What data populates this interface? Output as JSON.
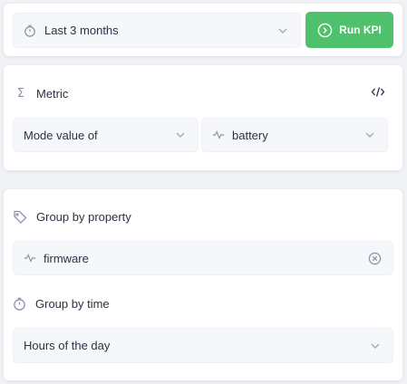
{
  "date_range": {
    "value": "Last 3 months"
  },
  "run_button": {
    "label": "Run KPI"
  },
  "metric": {
    "title": "Metric",
    "aggregation": "Mode value of",
    "property": "battery"
  },
  "group_by_property": {
    "title": "Group by property",
    "value": "firmware"
  },
  "group_by_time": {
    "title": "Group by time",
    "value": "Hours of the day"
  },
  "colors": {
    "accent_green": "#4fc06b",
    "field_bg": "#f5f7fb",
    "text": "#2b3245",
    "icon": "#8a92a6"
  },
  "icons": [
    "stopwatch-icon",
    "chevron-down-icon",
    "play-circle-icon",
    "sigma-icon",
    "code-icon",
    "activity-icon",
    "tag-icon",
    "clear-circle-icon"
  ]
}
